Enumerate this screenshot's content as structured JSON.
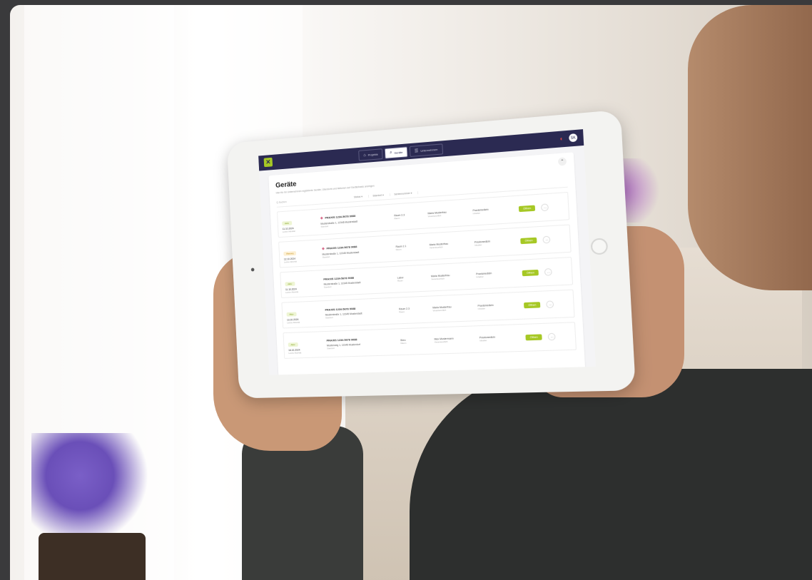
{
  "app": {
    "nav": [
      {
        "label": "Projekte",
        "icon": "house-icon"
      },
      {
        "label": "Geräte",
        "icon": "search-icon",
        "active": true
      },
      {
        "label": "Unternehmen",
        "icon": "list-icon"
      }
    ],
    "avatar_initials": "SK"
  },
  "page": {
    "title": "Geräte",
    "subtitle": "Hier für Ihr Unternehmen registrierte Geräte, Übersicht und Aktionen auf Gerätebasis anzeigen",
    "search_placeholder": "Q  Suchen",
    "filters": [
      "Status ▾",
      "Standort ▾",
      "Seriennummer ▾"
    ]
  },
  "devices": [
    {
      "badge": "Aktiv",
      "model": "PRAXIS 1234-5678 9088",
      "date": "11.10.2024",
      "date_sub": "Letzte Aktivität",
      "address": "Musterstraße 1, 12345 Musterstadt",
      "address_sub": "Standort",
      "room": "Raum 2.3",
      "room_sub": "Raum",
      "person": "Maria Musterfrau",
      "person_sub": "Verantwortlich",
      "owner": "Praxismedizin",
      "owner_sub": "Inhaber",
      "action": "Öffnen"
    },
    {
      "badge": "Wartung",
      "model": "PRAXIS 1234-5678 9088",
      "date": "12.10.2024",
      "date_sub": "Letzte Aktivität",
      "address": "Musterstraße 1, 12345 Musterstadt",
      "address_sub": "Standort",
      "room": "Raum 2.1",
      "room_sub": "Raum",
      "person": "Maria Musterfrau",
      "person_sub": "Verantwortlich",
      "owner": "Praxismedizin",
      "owner_sub": "Inhaber",
      "action": "Öffnen"
    },
    {
      "badge": "Aktiv",
      "model": "PRAXIS 1234-5678 9088",
      "date": "11.10.2024",
      "date_sub": "Letzte Aktivität",
      "address": "Musterstraße 1, 12345 Musterstadt",
      "address_sub": "Standort",
      "room": "Labor",
      "room_sub": "Raum",
      "person": "Maria Musterfrau",
      "person_sub": "Verantwortlich",
      "owner": "Praxismedizin",
      "owner_sub": "Inhaber",
      "action": "Öffnen"
    },
    {
      "badge": "Aktiv",
      "model": "PRAXIS 1234-5678 9088",
      "date": "13.10.2024",
      "date_sub": "Letzte Aktivität",
      "address": "Musterstraße 1, 12345 Musterstadt",
      "address_sub": "Standort",
      "room": "Raum 2.3",
      "room_sub": "Raum",
      "person": "Maria Musterfrau",
      "person_sub": "Verantwortlich",
      "owner": "Praxismedizin",
      "owner_sub": "Inhaber",
      "action": "Öffnen"
    },
    {
      "badge": "Aktiv",
      "model": "PRAXIS 1234-5678 9088",
      "date": "16.10.2024",
      "date_sub": "Letzte Aktivität",
      "address": "Musterweg 1, 12345 Musterdorf",
      "address_sub": "Standort",
      "room": "Büro",
      "room_sub": "Raum",
      "person": "Max Mustermann",
      "person_sub": "Verantwortlich",
      "owner": "Praxismedizin",
      "owner_sub": "Inhaber",
      "action": "Öffnen"
    }
  ],
  "colors": {
    "topbar": "#2b2a52",
    "accent": "#a6c825",
    "alert": "#e04848"
  }
}
